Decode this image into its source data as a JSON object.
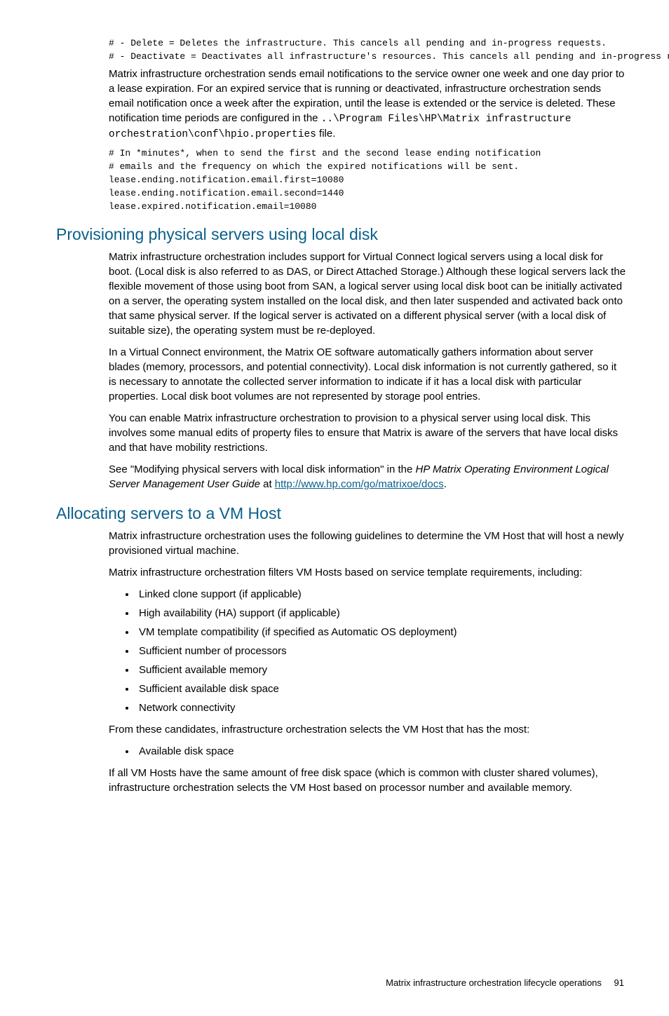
{
  "codeTop": {
    "l1": "# - Delete = Deletes the infrastructure. This cancels all pending and in-progress requests.",
    "l2": "# - Deactivate = Deactivates all infrastructure's resources. This cancels all pending and in-progress requests."
  },
  "para1_a": "Matrix infrastructure orchestration sends email notifications to the service owner one week and one day prior to a lease expiration. For an expired service that is running or deactivated, infrastructure orchestration sends email notification once a week after the expiration, until the lease is extended or the service is deleted. These notification time periods are configured in the ",
  "para1_code": "..\\Program Files\\HP\\Matrix infrastructure orchestration\\conf\\hpio.properties",
  "para1_b": " file.",
  "codeBlock2": {
    "l1": "# In *minutes*, when to send the first and the second lease ending notification",
    "l2": "# emails and the frequency on which the expired notifications will be sent.",
    "l3": "lease.ending.notification.email.first=10080",
    "l4": "lease.ending.notification.email.second=1440",
    "l5": "lease.expired.notification.email=10080"
  },
  "h2a": "Provisioning physical servers using local disk",
  "para2": "Matrix infrastructure orchestration includes support for Virtual Connect logical servers using a local disk for boot. (Local disk is also referred to as DAS, or Direct Attached Storage.) Although these logical servers lack the flexible movement of those using boot from SAN, a logical server using local disk boot can be initially activated on a server, the operating system installed on the local disk, and then later suspended and activated back onto that same physical server. If the logical server is activated on a different physical server (with a local disk of suitable size), the operating system must be re-deployed.",
  "para3": "In a Virtual Connect environment, the Matrix OE software automatically gathers information about server blades (memory, processors, and potential connectivity). Local disk information is not currently gathered, so it is necessary to annotate the collected server information to indicate if it has a local disk with particular properties. Local disk boot volumes are not represented by storage pool entries.",
  "para4": "You can enable Matrix infrastructure orchestration to provision to a physical server using local disk. This involves some manual edits of property files to ensure that Matrix is aware of the servers that have local disks and that have mobility restrictions.",
  "para5_a": "See \"Modifying physical servers with local disk information\" in the ",
  "para5_em": "HP Matrix Operating Environment Logical Server Management User Guide",
  "para5_b": " at ",
  "para5_link": "http://www.hp.com/go/matrixoe/docs",
  "para5_c": ".",
  "h2b": "Allocating servers to a VM Host",
  "para6": "Matrix infrastructure orchestration uses the following guidelines to determine the VM Host that will host a newly provisioned virtual machine.",
  "para7": "Matrix infrastructure orchestration filters VM Hosts based on service template requirements, including:",
  "bullets1": {
    "i0": "Linked clone support (if applicable)",
    "i1": "High availability (HA) support (if applicable)",
    "i2": "VM template compatibility (if specified as Automatic OS deployment)",
    "i3": "Sufficient number of processors",
    "i4": "Sufficient available memory",
    "i5": "Sufficient available disk space",
    "i6": "Network connectivity"
  },
  "para8": "From these candidates, infrastructure orchestration selects the VM Host that has the most:",
  "bullets2": {
    "i0": "Available disk space"
  },
  "para9": "If all VM Hosts have the same amount of free disk space (which is common with cluster shared volumes), infrastructure orchestration selects the VM Host based on processor number and available memory.",
  "footer": {
    "title": "Matrix infrastructure orchestration lifecycle operations",
    "page": "91"
  }
}
